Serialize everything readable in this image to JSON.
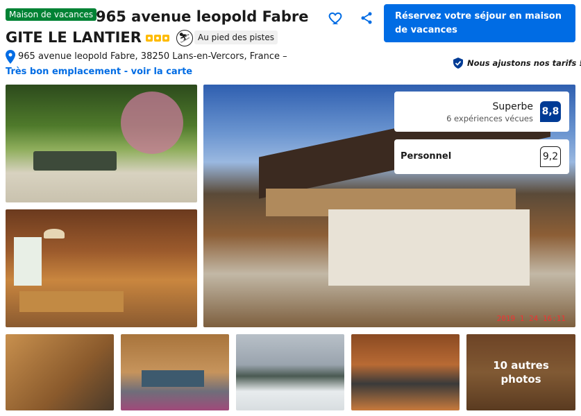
{
  "property": {
    "type_badge": "Maison de vacances",
    "name_line1": "965 avenue leopold Fabre",
    "name_line2": "GITE LE LANTIER",
    "stars": 3,
    "ski_tag": "Au pied des pistes",
    "address": "965 avenue leopold Fabre, 38250 Lans-en-Vercors, France –",
    "map_link": "Très bon emplacement - voir la carte",
    "price_match": "Nous ajustons nos tarifs !"
  },
  "actions": {
    "reserve_label": "Réservez votre séjour en maison de vacances",
    "save_icon": "heart-icon",
    "share_icon": "share-icon"
  },
  "rating": {
    "label": "Superbe",
    "reviews": "6 expériences vécues",
    "score": "8,8",
    "staff_label": "Personnel",
    "staff_score": "9,2"
  },
  "gallery": {
    "more_photos": "10 autres photos",
    "main_timestamp": "2019  1 24  16:11"
  },
  "colors": {
    "brand_blue": "#006ce4",
    "dark_blue": "#003b95",
    "green_badge": "#008234",
    "star_yellow": "#febb02"
  }
}
